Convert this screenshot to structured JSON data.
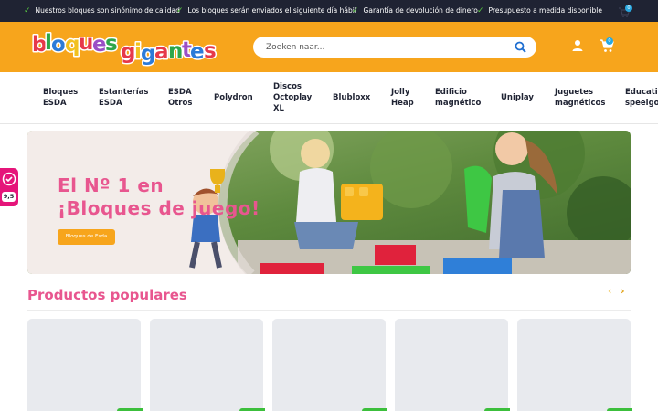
{
  "usps": [
    {
      "text": "Nuestros bloques son sinónimo de calidad"
    },
    {
      "text": "Los bloques serán enviados el siguiente día hábil"
    },
    {
      "text": "Garantía de devolución de dinero"
    },
    {
      "text": "Presupuesto a medida disponible"
    }
  ],
  "cart": {
    "count": "0"
  },
  "logo": {
    "text": "Bloques gigantes"
  },
  "search": {
    "placeholder": "Zoeken naar..."
  },
  "nav": {
    "items": [
      {
        "label": "Bloques\nESDA"
      },
      {
        "label": "Estanterías\nESDA"
      },
      {
        "label": "ESDA\nOtros"
      },
      {
        "label": "Polydron"
      },
      {
        "label": "Discos\nOctoplay\nXL"
      },
      {
        "label": "Blubloxx"
      },
      {
        "label": "Jolly\nHeap"
      },
      {
        "label": "Edificio\nmagnético"
      },
      {
        "label": "Uniplay"
      },
      {
        "label": "Juguetes\nmagnéticos"
      },
      {
        "label": "Educatio\nspeelgoe"
      }
    ]
  },
  "hero": {
    "title": "El Nº 1 en\n¡Bloques de juego!",
    "button_label": "Bloques de Esda"
  },
  "rating": {
    "value": "9,5"
  },
  "products": {
    "title": "Productos populares",
    "prev_icon": "‹",
    "next_icon": "›"
  },
  "colors": {
    "accent": "#f7a51c",
    "brand_pink": "#e8568f",
    "dark": "#1f2333",
    "check_green": "#58c742"
  }
}
